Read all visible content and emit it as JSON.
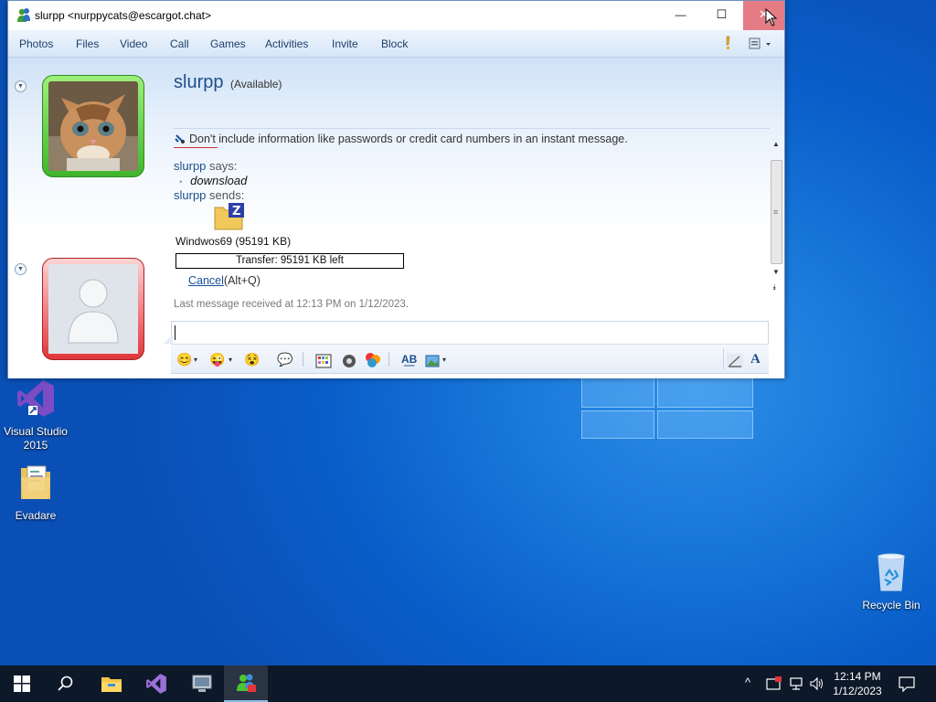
{
  "window": {
    "title": "slurpp <nurppycats@escargot.chat>",
    "min_glyph": "—",
    "max_glyph": "☐",
    "close_glyph": "✕"
  },
  "menu": {
    "items": [
      "Photos",
      "Files",
      "Video",
      "Call",
      "Games",
      "Activities",
      "Invite",
      "Block"
    ]
  },
  "contact": {
    "name": "slurpp",
    "status": "(Available)"
  },
  "conversation": {
    "warning": "Don't include information like passwords or credit card numbers in an instant message.",
    "says_name": "slurpp",
    "says_text": " says:",
    "message": "downsload",
    "sends_name": "slurpp",
    "sends_text": " sends:",
    "file_name": "Windwos69 (95191 KB)",
    "transfer_text": "Transfer: 95191 KB left",
    "cancel_link": "Cancel",
    "cancel_shortcut": "(Alt+Q)",
    "last_message": "Last message received at 12:13 PM on 1/12/2023."
  },
  "input": {
    "value": ""
  },
  "desktop": {
    "icons": [
      {
        "label": "Visual Studio 2015",
        "icon": "visual-studio-icon"
      },
      {
        "label": "Evadare",
        "icon": "document-folder-icon"
      },
      {
        "label": "Recycle Bin",
        "icon": "recycle-bin-icon"
      }
    ]
  },
  "taskbar": {
    "time": "12:14 PM",
    "date": "1/12/2023"
  },
  "colors": {
    "desktop_blue": "#0a5ec9",
    "presence_green": "#4ec630",
    "presence_red": "#e0363a",
    "link_blue": "#1a4e9b",
    "taskbar": "#0d1929"
  }
}
